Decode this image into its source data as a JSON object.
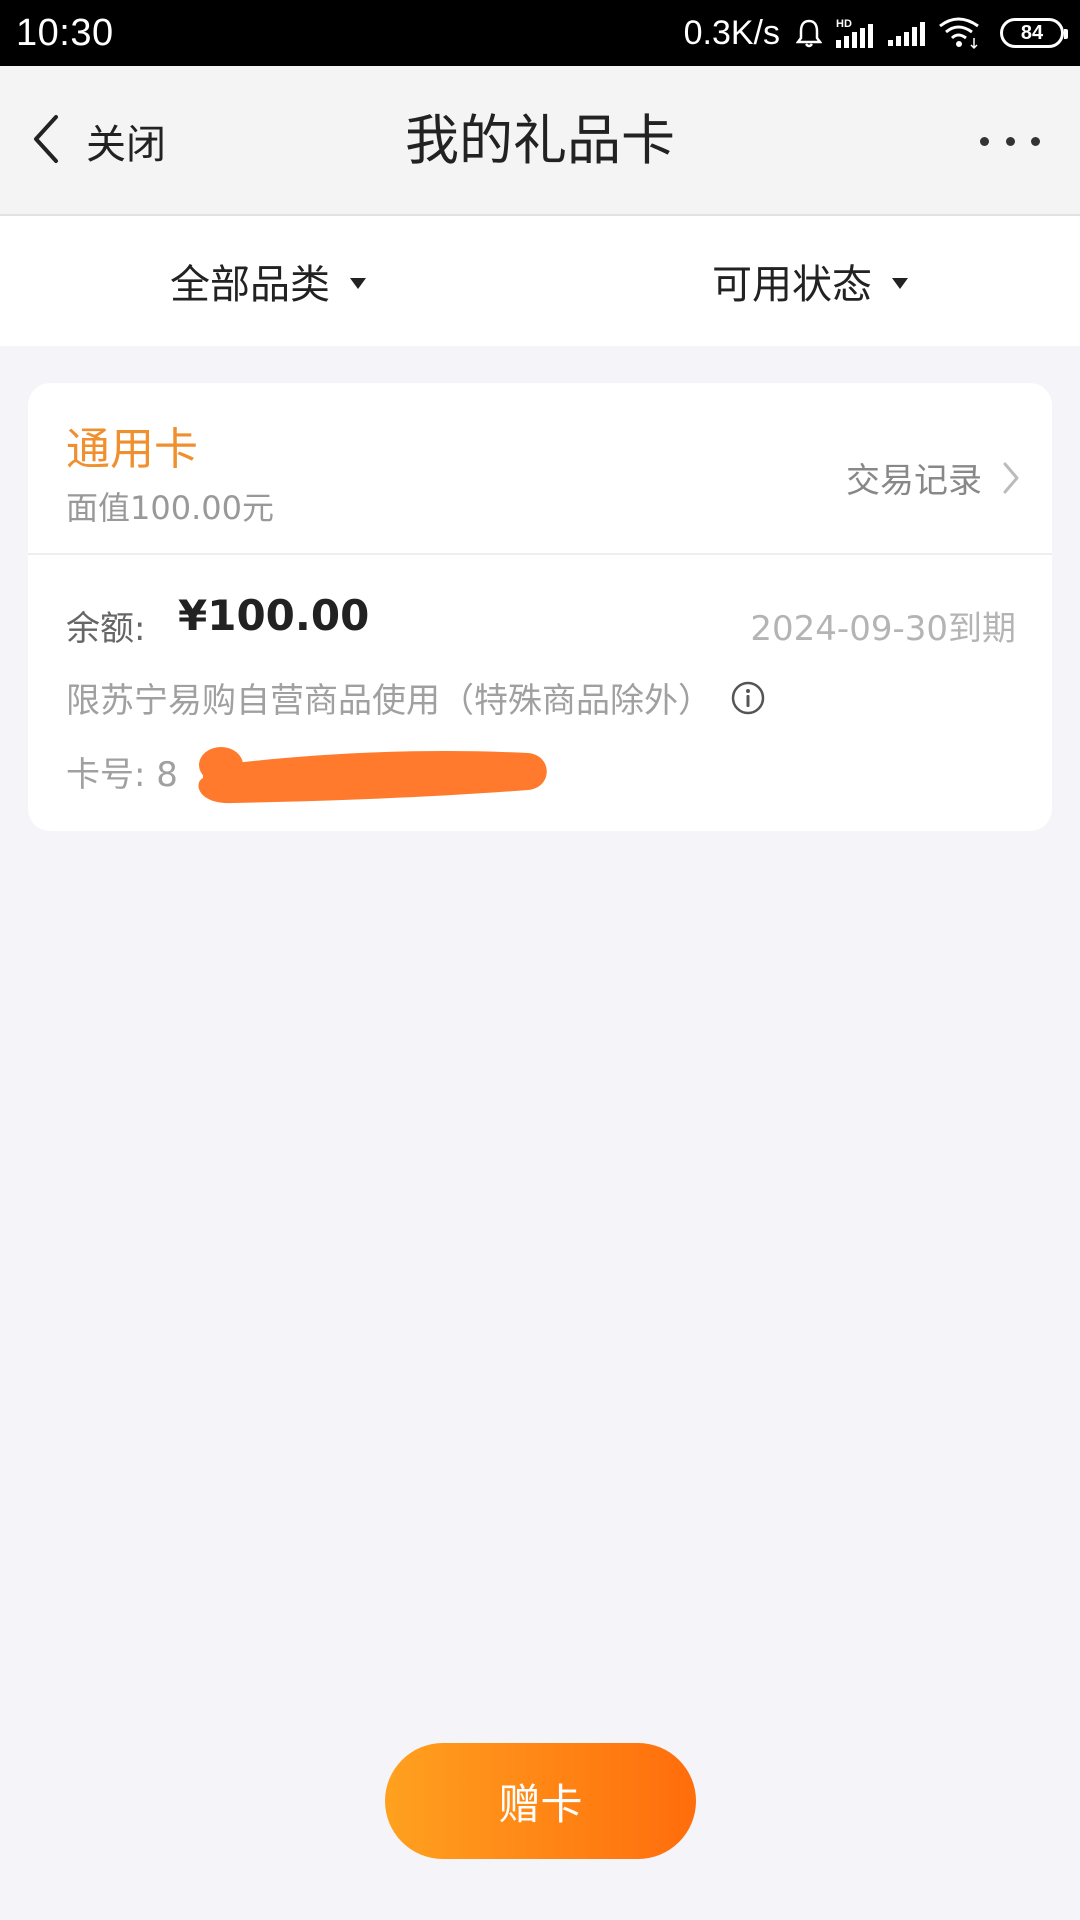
{
  "status_bar": {
    "time": "10:30",
    "speed": "0.3K/s",
    "battery_level": "84"
  },
  "nav": {
    "back_label": "关闭",
    "title": "我的礼品卡"
  },
  "filters": {
    "category": "全部品类",
    "status": "可用状态"
  },
  "card": {
    "type": "通用卡",
    "face_value": "面值100.00元",
    "transaction_link": "交易记录",
    "balance_label": "余额:",
    "balance_value": "¥100.00",
    "expiry": "2024-09-30到期",
    "usage_note": "限苏宁易购自营商品使用（特殊商品除外）",
    "card_number_label": "卡号: 8"
  },
  "actions": {
    "gift_card": "赠卡"
  },
  "colors": {
    "accent": "#f08f2d",
    "button_start": "#ffa11f",
    "button_end": "#ff6d0c",
    "redaction": "#ff7a2c"
  }
}
